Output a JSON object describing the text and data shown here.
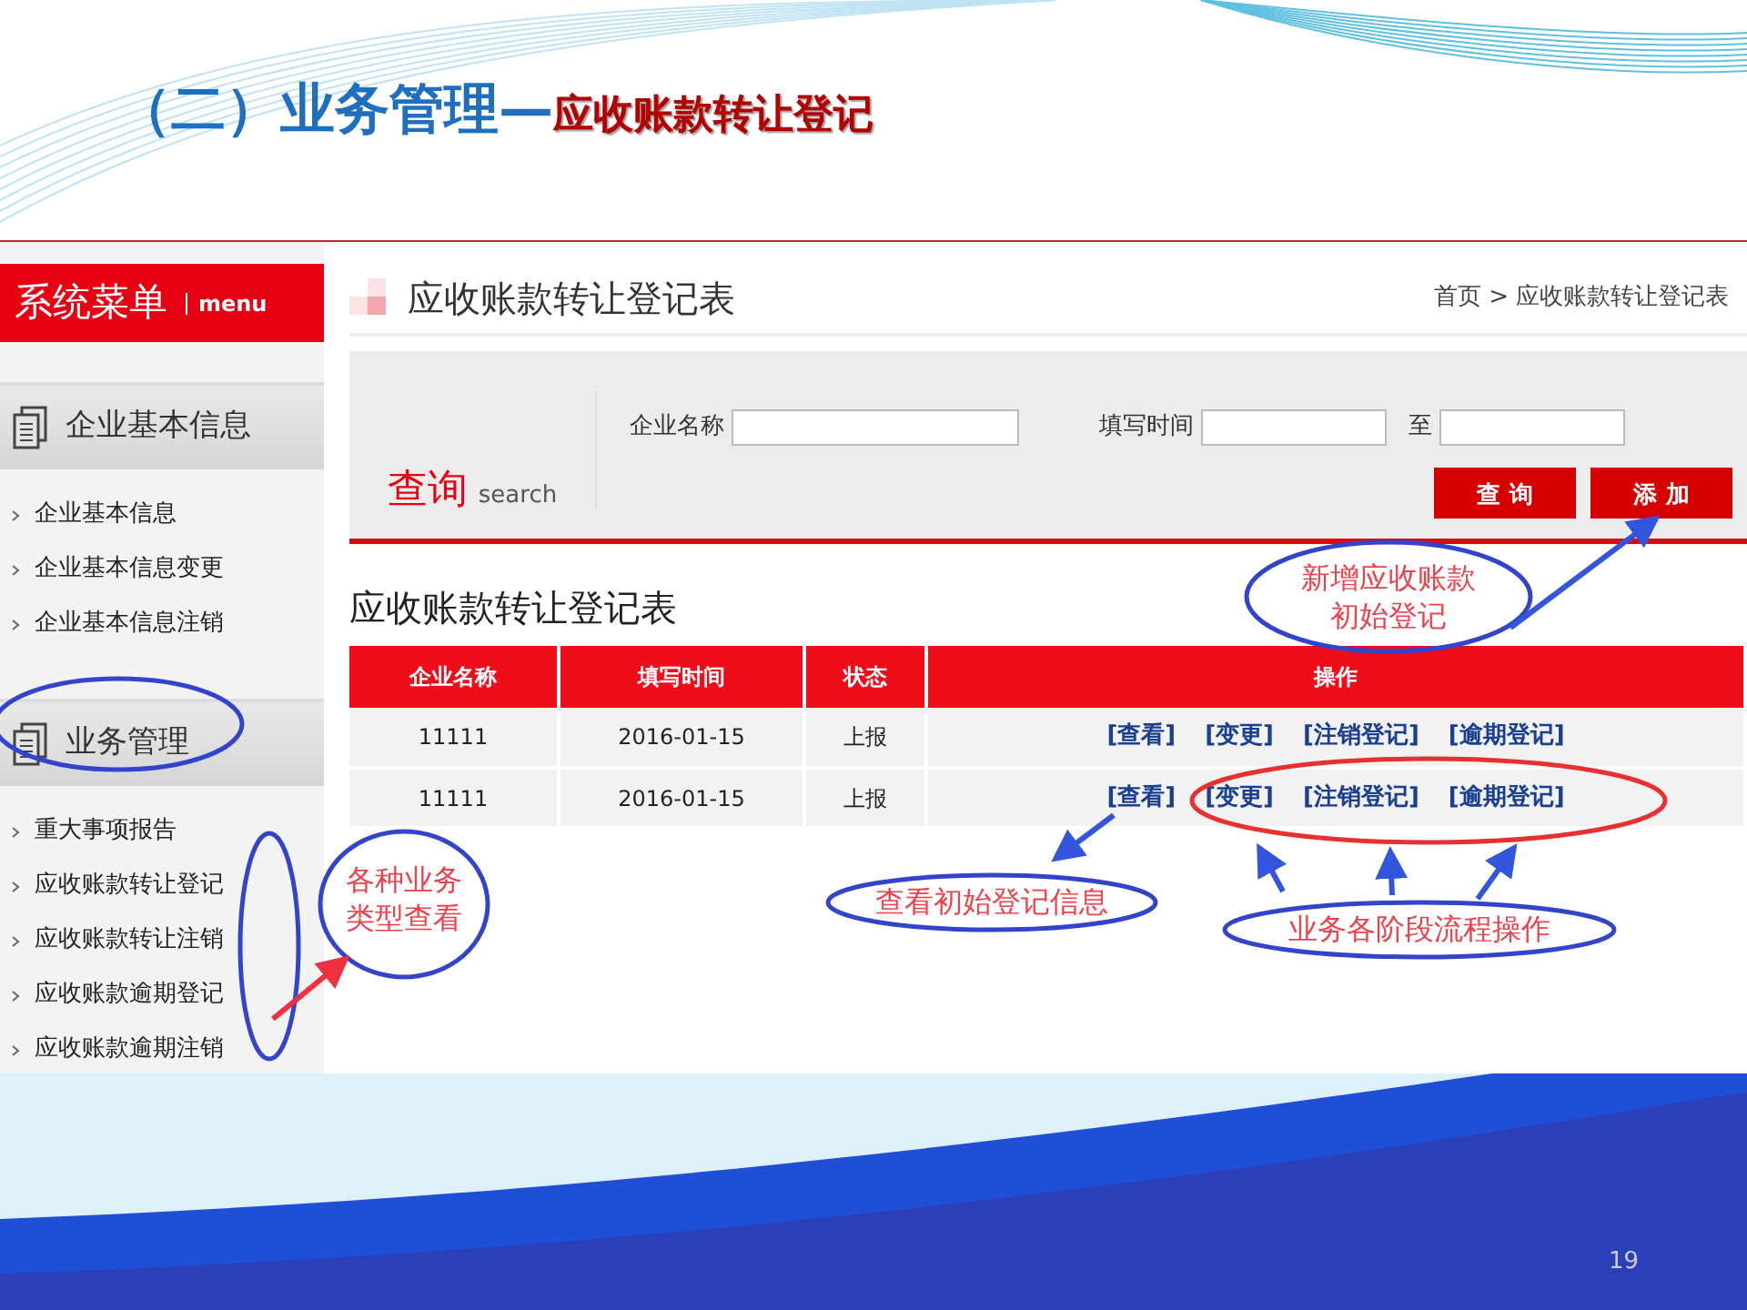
{
  "slide": {
    "title_main": "（二）业务管理—",
    "title_sub": "应收账款转让登记",
    "page_number": "19"
  },
  "sidebar": {
    "header": "系统菜单",
    "header_en": "menu",
    "groups": [
      {
        "title": "企业基本信息",
        "items": [
          "企业基本信息",
          "企业基本信息变更",
          "企业基本信息注销"
        ]
      },
      {
        "title": "业务管理",
        "items": [
          "重大事项报告",
          "应收账款转让登记",
          "应收账款转让注销",
          "应收账款逾期登记",
          "应收账款逾期注销"
        ]
      }
    ]
  },
  "page": {
    "title": "应收账款转让登记表",
    "breadcrumb": {
      "items": [
        "首页",
        "应收账款转让登记表"
      ],
      "separator": ">"
    },
    "search": {
      "label": "查询",
      "label_en": "search",
      "fields": [
        {
          "label": "企业名称"
        },
        {
          "label": "填写时间"
        },
        {
          "label": "至"
        }
      ],
      "buttons": [
        "查 询",
        "添 加"
      ]
    },
    "table": {
      "title": "应收账款转让登记表",
      "columns": [
        "企业名称",
        "填写时间",
        "状态",
        "操作"
      ],
      "rows": [
        {
          "cells": [
            "11111",
            "2016-01-15",
            "上报"
          ],
          "actions": [
            "[查看]",
            "[变更]",
            "[注销登记]",
            "[逾期登记]"
          ]
        },
        {
          "cells": [
            "11111",
            "2016-01-15",
            "上报"
          ],
          "actions": [
            "[查看]",
            "[变更]",
            "[注销登记]",
            "[逾期登记]"
          ]
        }
      ]
    }
  },
  "annotations": [
    {
      "lines": [
        "新增应收账款",
        "初始登记"
      ]
    },
    {
      "lines": [
        "各种业务",
        "类型查看"
      ]
    },
    {
      "lines": [
        "查看初始登记信息"
      ]
    },
    {
      "lines": [
        "业务各阶段流程操作"
      ]
    }
  ]
}
